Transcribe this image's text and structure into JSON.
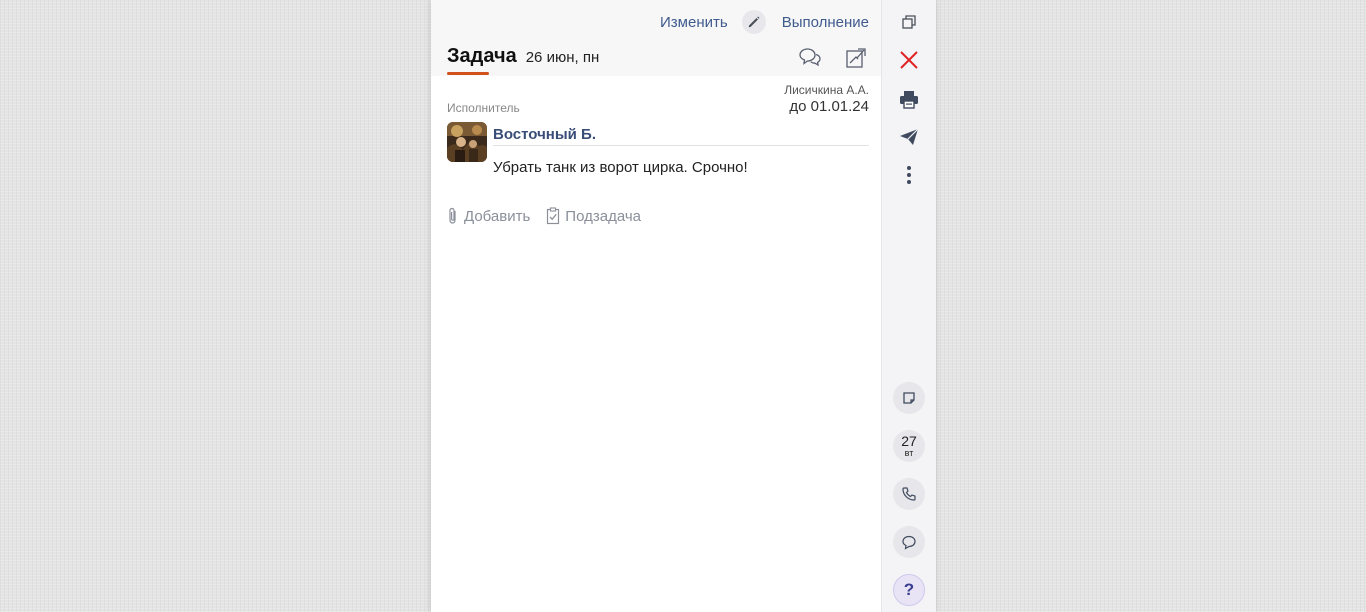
{
  "header": {
    "edit_label": "Изменить",
    "execution_label": "Выполнение",
    "title": "Задача",
    "date": "26 июн, пн"
  },
  "task": {
    "author": "Лисичкина А.А.",
    "deadline": "до 01.01.24",
    "role_label": "Исполнитель",
    "performer": "Восточный Б.",
    "text": "Убрать танк из ворот цирка. Срочно!"
  },
  "actions": {
    "add_label": "Добавить",
    "subtask_label": "Подзадача"
  },
  "sidebar": {
    "calendar_day": "27",
    "calendar_weekday": "вт",
    "help_label": "?"
  },
  "icons": [
    "pencil-icon",
    "chat-icon",
    "document-icon",
    "copy-icon",
    "close-icon",
    "print-icon",
    "send-icon",
    "more-icon",
    "note-icon",
    "phone-icon",
    "comment-icon",
    "paperclip-icon",
    "checklist-icon"
  ],
  "colors": {
    "accent": "#d2501a",
    "link": "#3f5b8e",
    "delete": "#e02424"
  }
}
